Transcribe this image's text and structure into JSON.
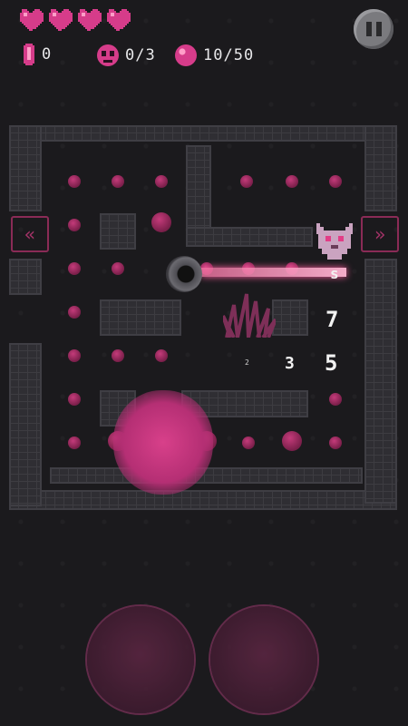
{
  "hud": {
    "lives": 4,
    "gems": "0",
    "skulls": "0/3",
    "orbs": "10/50"
  },
  "controls": {
    "left_arrow": "«",
    "right_arrow": "»"
  },
  "damage_numbers": [
    "7",
    "3",
    "5"
  ],
  "small_markers": [
    "s",
    "2"
  ],
  "colors": {
    "accent": "#e23d86",
    "wall": "#2f2e33",
    "background": "#1b1a1d"
  }
}
